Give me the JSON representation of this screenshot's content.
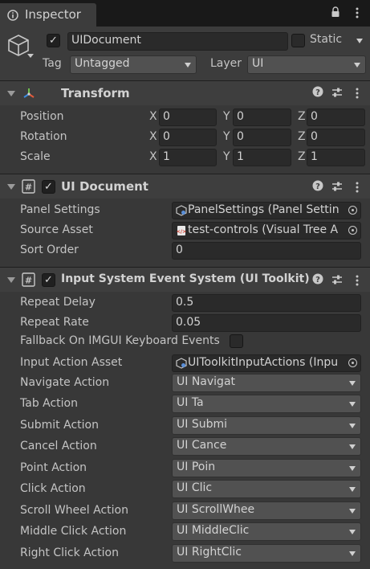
{
  "tab": {
    "title": "Inspector"
  },
  "gameobject": {
    "active": true,
    "name": "UIDocument",
    "static_label": "Static",
    "tag_label": "Tag",
    "tag_value": "Untagged",
    "layer_label": "Layer",
    "layer_value": "UI"
  },
  "transform": {
    "title": "Transform",
    "position": {
      "label": "Position",
      "x": "0",
      "y": "0",
      "z": "0"
    },
    "rotation": {
      "label": "Rotation",
      "x": "0",
      "y": "0",
      "z": "0"
    },
    "scale": {
      "label": "Scale",
      "x": "1",
      "y": "1",
      "z": "1"
    },
    "axis": {
      "x": "X",
      "y": "Y",
      "z": "Z"
    }
  },
  "ui_document": {
    "title": "UI Document",
    "panel_settings_label": "Panel Settings",
    "panel_settings_value": "PanelSettings (Panel Settin",
    "source_asset_label": "Source Asset",
    "source_asset_value": "test-controls (Visual Tree A",
    "sort_order_label": "Sort Order",
    "sort_order_value": "0"
  },
  "event_system": {
    "title": "Input System Event System (UI Toolkit)",
    "repeat_delay_label": "Repeat Delay",
    "repeat_delay_value": "0.5",
    "repeat_rate_label": "Repeat Rate",
    "repeat_rate_value": "0.05",
    "fallback_label": "Fallback On IMGUI Keyboard Events",
    "fallback_checked": false,
    "input_action_asset_label": "Input Action Asset",
    "input_action_asset_value": "UIToolkitInputActions (Inpu",
    "actions": [
      {
        "label": "Navigate Action",
        "value": "UI Navigat"
      },
      {
        "label": "Tab Action",
        "value": "UI Ta"
      },
      {
        "label": "Submit Action",
        "value": "UI Submi"
      },
      {
        "label": "Cancel Action",
        "value": "UI Cance"
      },
      {
        "label": "Point Action",
        "value": "UI Poin"
      },
      {
        "label": "Click Action",
        "value": "UI Clic"
      },
      {
        "label": "Scroll Wheel Action",
        "value": "UI ScrollWhee"
      },
      {
        "label": "Middle Click Action",
        "value": "UI MiddleClic"
      },
      {
        "label": "Right Click Action",
        "value": "UI RightClic"
      }
    ]
  },
  "icons": {
    "tab": "info-icon",
    "menu": "kebab-menu-icon",
    "lock": "lock-icon",
    "help": "help-icon",
    "presets": "sliders-icon",
    "gameobject": "cube-icon",
    "transform": "transform-axes-icon",
    "script": "hash-script-icon"
  },
  "colors": {
    "background": "#383838",
    "tabbar": "#191919",
    "field": "#2a2a2a",
    "dropdown": "#515151",
    "text": "#c4c4c4"
  }
}
